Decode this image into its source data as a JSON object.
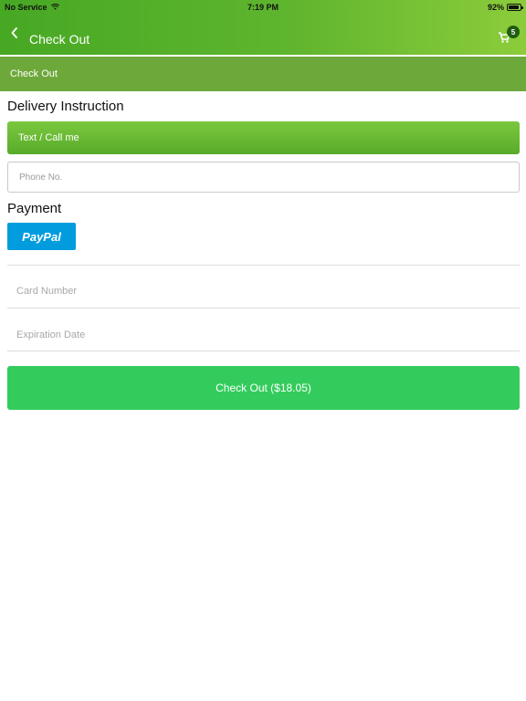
{
  "status_bar": {
    "carrier": "No Service",
    "time": "7:19 PM",
    "battery_percent": "92%",
    "battery_level": 0.92
  },
  "nav": {
    "title": "Check Out",
    "cart_count": "5",
    "back_icon": "chevron-left-icon",
    "cart_icon": "cart-icon"
  },
  "sub_header": {
    "title": "Check Out"
  },
  "delivery": {
    "heading": "Delivery Instruction",
    "option_label": "Text / Call me",
    "phone_placeholder": "Phone No."
  },
  "payment": {
    "heading": "Payment",
    "paypal_label": "PayPal",
    "card_number_placeholder": "Card Number",
    "expiration_placeholder": "Expiration Date"
  },
  "checkout_button": {
    "label": "Check Out ($18.05)"
  },
  "colors": {
    "header_gradient_start": "#47a824",
    "header_gradient_end": "#8ccc3b",
    "sub_header": "#6da83a",
    "paypal_blue": "#009cde",
    "checkout_green": "#33cc5c"
  }
}
